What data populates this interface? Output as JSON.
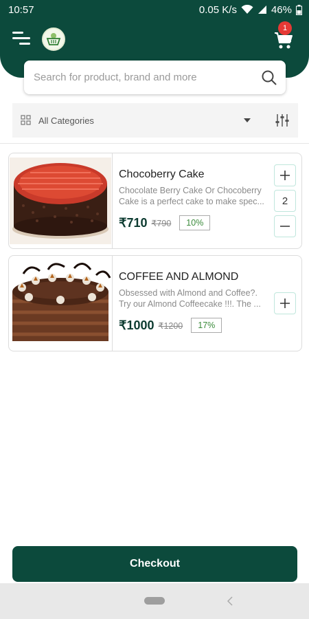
{
  "status_bar": {
    "time": "10:57",
    "network_speed": "0.05 K/s",
    "battery": "46%"
  },
  "header": {
    "cart_count": "1"
  },
  "search": {
    "placeholder": "Search for product, brand and more"
  },
  "category": {
    "selected": "All Categories"
  },
  "products": [
    {
      "name": "Chocoberry Cake",
      "description": "Chocolate Berry Cake Or Chocoberry Cake is a perfect cake to make spec...",
      "price": "₹710",
      "mrp": "₹790",
      "discount": "10%",
      "quantity": "2"
    },
    {
      "name": "COFFEE AND ALMOND",
      "description": "Obsessed with Almond and Coffee?. Try our Almond Coffeecake !!!. The ...",
      "price": "₹1000",
      "mrp": "₹1200",
      "discount": "17%"
    }
  ],
  "checkout": {
    "label": "Checkout"
  },
  "colors": {
    "brand": "#0c4a3c",
    "badge": "#e53935",
    "discount_text": "#3a8a3a"
  },
  "icons": [
    "menu-icon",
    "basket-logo-icon",
    "cart-icon",
    "search-icon",
    "category-grid-icon",
    "dropdown-arrow-icon",
    "filter-sliders-icon",
    "plus-icon",
    "minus-icon",
    "back-icon"
  ]
}
